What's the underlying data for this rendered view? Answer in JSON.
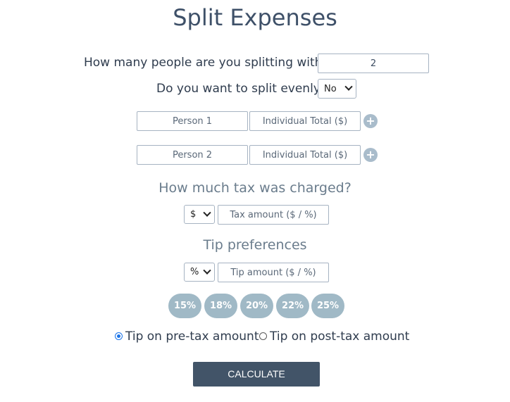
{
  "title": "Split Expenses",
  "people": {
    "question": "How many people are you splitting with?",
    "count_value": "2"
  },
  "split_evenly": {
    "question": "Do you want to split evenly?",
    "selected": "No"
  },
  "persons": [
    {
      "name_placeholder": "Person 1",
      "total_placeholder": "Individual Total ($)",
      "add_label": "+"
    },
    {
      "name_placeholder": "Person 2",
      "total_placeholder": "Individual Total ($)",
      "add_label": "+"
    }
  ],
  "tax": {
    "heading": "How much tax was charged?",
    "unit_selected": "$",
    "amount_placeholder": "Tax amount ($ / %)"
  },
  "tip": {
    "heading": "Tip preferences",
    "unit_selected": "%",
    "amount_placeholder": "Tip amount ($ / %)",
    "presets": [
      "15%",
      "18%",
      "20%",
      "22%",
      "25%"
    ],
    "options": [
      {
        "label": "Tip on pre-tax amount",
        "checked": true
      },
      {
        "label": "Tip on post-tax amount",
        "checked": false
      }
    ]
  },
  "calculate_label": "CALCULATE",
  "colors": {
    "title": "#3e5068",
    "section_heading": "#6a7c8c",
    "pill": "#a0b9c6",
    "button": "#425468",
    "radio_selected": "#1a73e8"
  }
}
